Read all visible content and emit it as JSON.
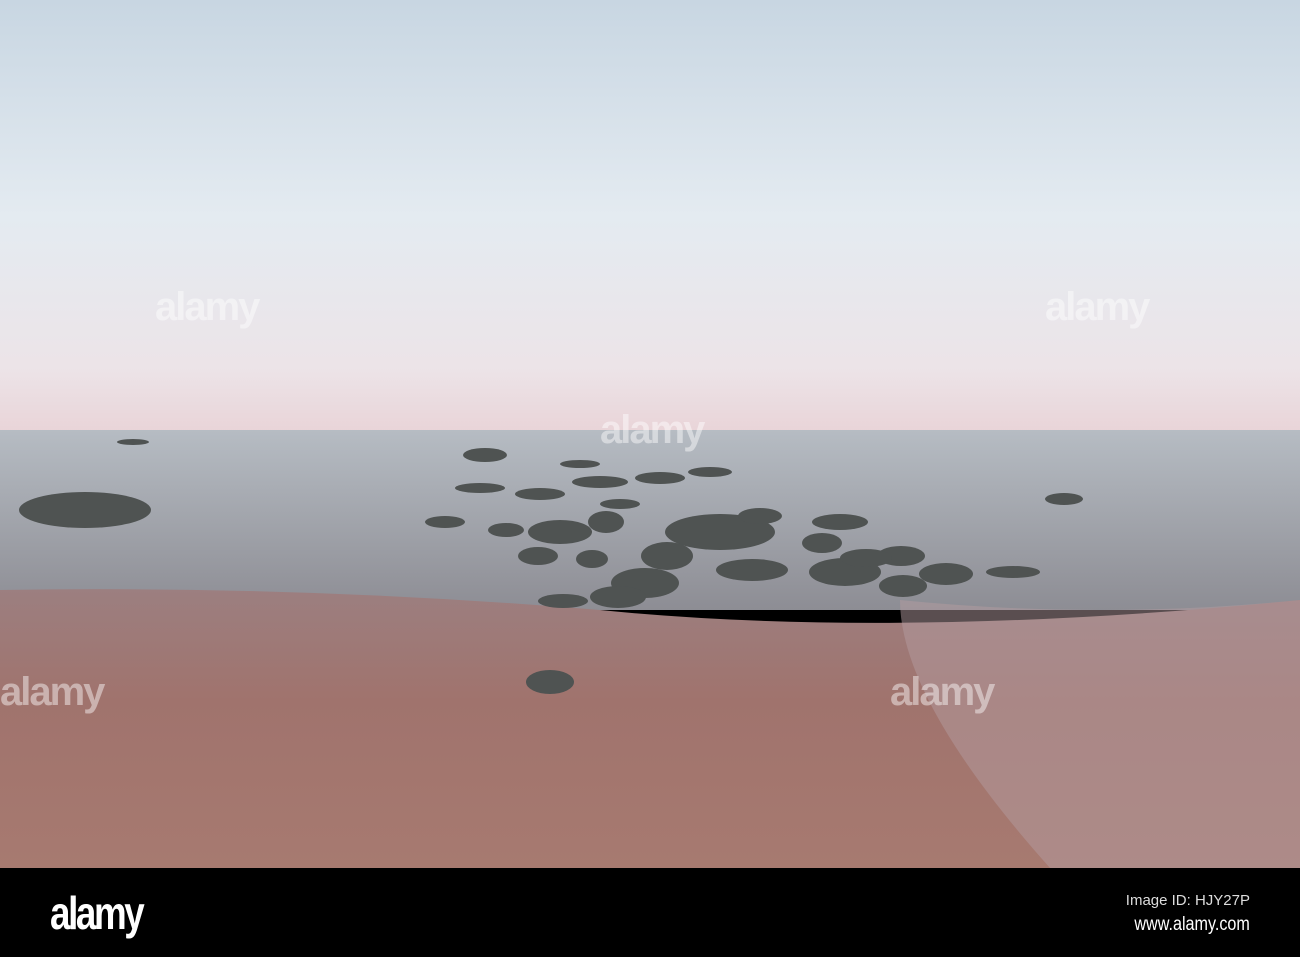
{
  "watermark": {
    "text": "alamy"
  },
  "footer": {
    "logo": "alamy",
    "image_id": "Image ID: HJY27P",
    "url": "www.alamy.com"
  },
  "colors": {
    "sky": "#dfe7ee",
    "sea": "#8e969d",
    "sand": "#a57a72",
    "rock": "#4d5150"
  }
}
